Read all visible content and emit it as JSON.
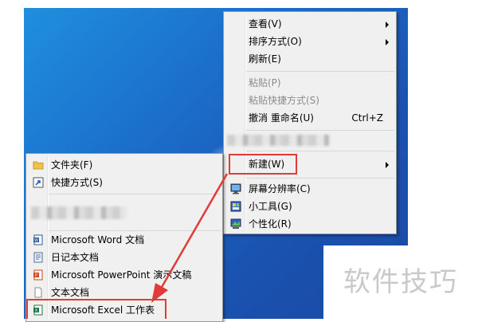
{
  "context_menu": {
    "items": [
      {
        "label": "查看(V)",
        "submenu": true,
        "disabled": false
      },
      {
        "label": "排序方式(O)",
        "submenu": true,
        "disabled": false
      },
      {
        "label": "刷新(E)",
        "submenu": false,
        "disabled": false
      },
      {
        "label": "粘贴(P)",
        "submenu": false,
        "disabled": true
      },
      {
        "label": "粘贴快捷方式(S)",
        "submenu": false,
        "disabled": true
      },
      {
        "label": "撤消 重命名(U)",
        "shortcut": "Ctrl+Z",
        "disabled": false
      },
      {
        "label": "新建(W)",
        "submenu": true,
        "highlighted": true
      },
      {
        "label": "屏幕分辨率(C)",
        "icon": "monitor-icon"
      },
      {
        "label": "小工具(G)",
        "icon": "gadgets-icon"
      },
      {
        "label": "个性化(R)",
        "icon": "personalize-icon"
      }
    ]
  },
  "new_submenu": {
    "items": [
      {
        "label": "文件夹(F)",
        "icon": "folder-icon"
      },
      {
        "label": "快捷方式(S)",
        "icon": "shortcut-icon"
      },
      {
        "label": "Microsoft Word 文档",
        "icon": "word-doc-icon"
      },
      {
        "label": "日记本文档",
        "icon": "journal-doc-icon"
      },
      {
        "label": "Microsoft PowerPoint 演示文稿",
        "icon": "powerpoint-icon"
      },
      {
        "label": "文本文档",
        "icon": "text-doc-icon"
      },
      {
        "label": "Microsoft Excel 工作表",
        "icon": "excel-icon"
      }
    ]
  },
  "watermark": {
    "text": "软件技巧"
  },
  "colors": {
    "highlight_box": "#e03a3a",
    "arrow": "#e03a3a",
    "desktop": "#1b6fcb"
  }
}
